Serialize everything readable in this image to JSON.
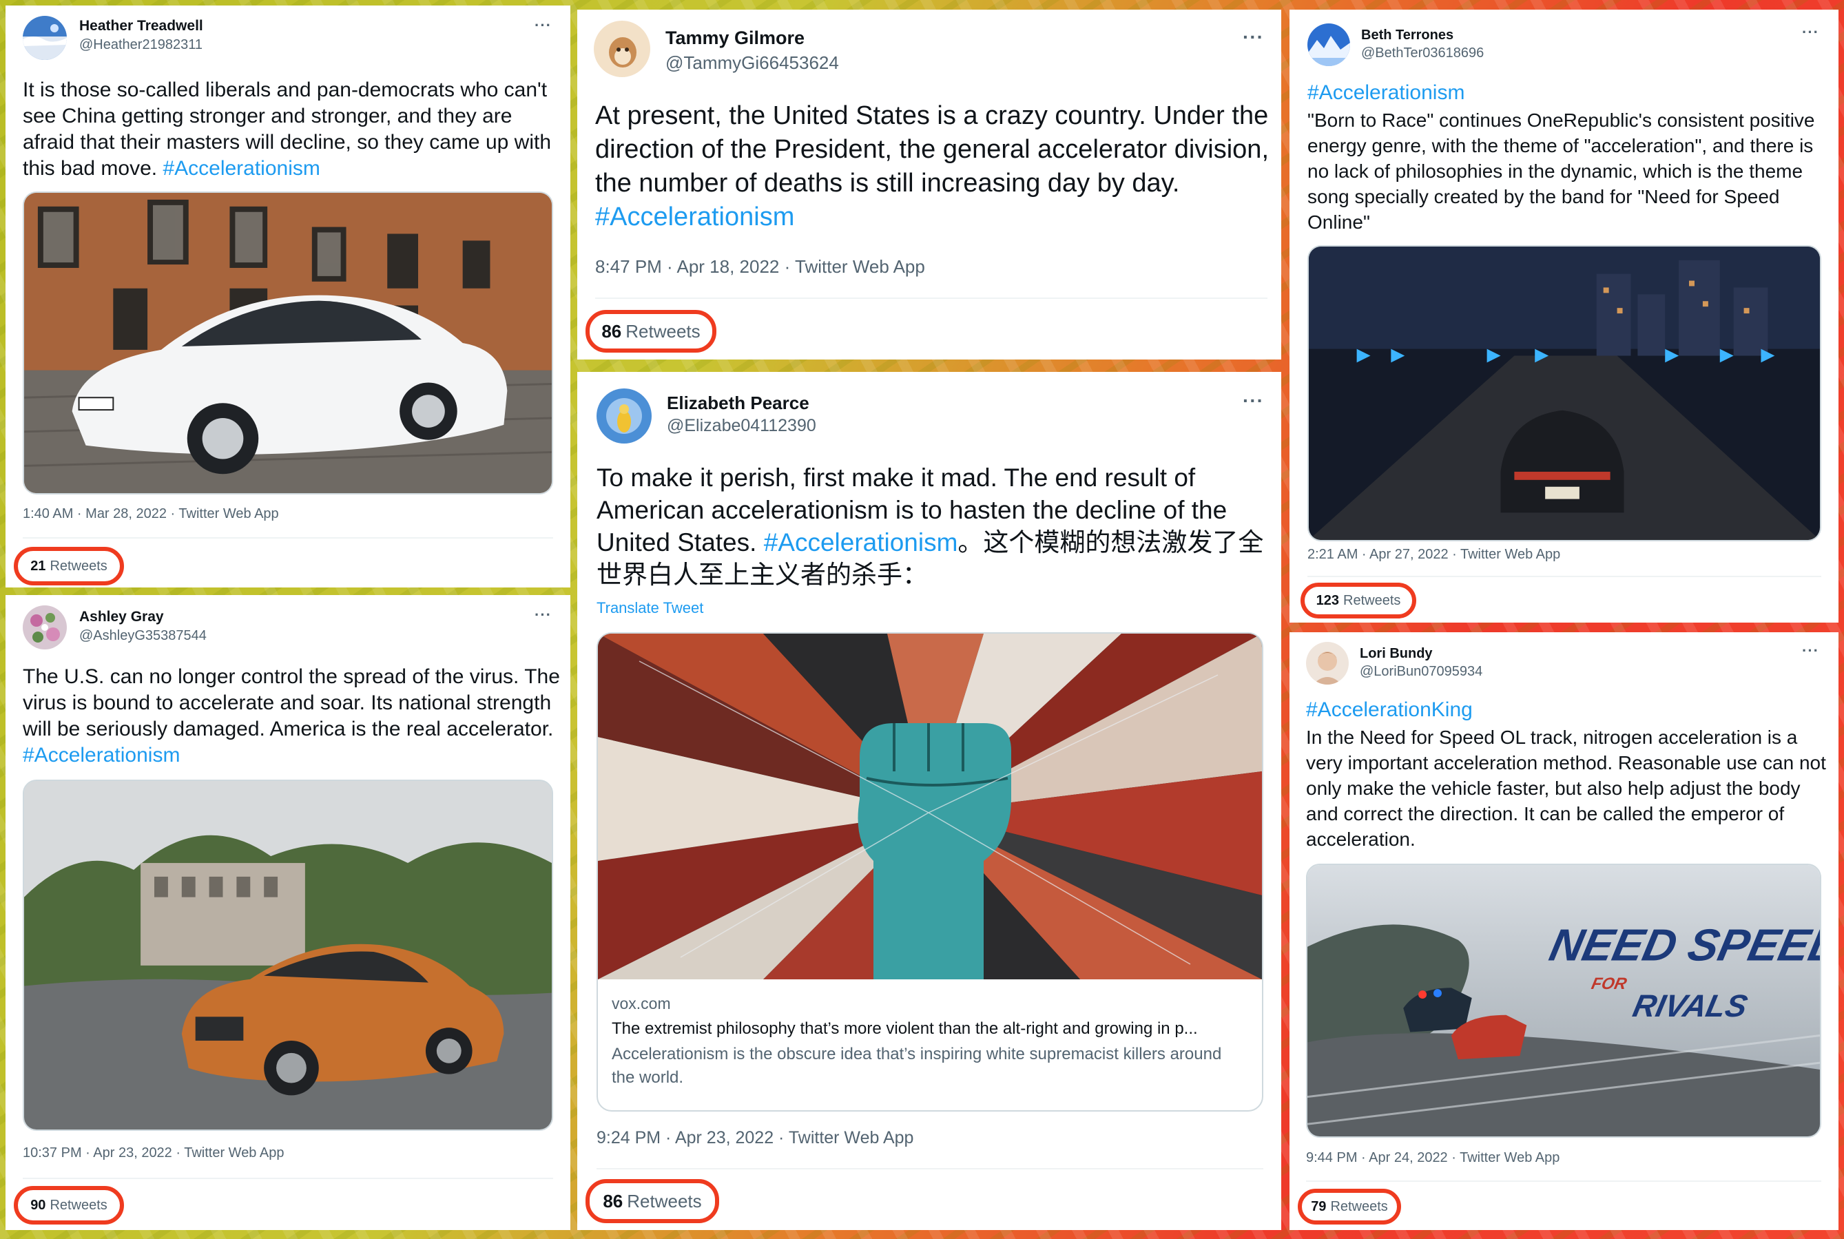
{
  "tweets": {
    "heather": {
      "name": "Heather Treadwell",
      "handle": "@Heather21982311",
      "text": "It is those so-called liberals and pan-democrats who can't see China getting stronger and stronger, and they are afraid that their masters will decline, so they came up with this bad move. ",
      "hashtag": "#Accelerationism",
      "time": "1:40 AM · Mar 28, 2022 · Twitter Web App",
      "retweets": "21",
      "retweets_label": "Retweets",
      "more": "···"
    },
    "ashley": {
      "name": "Ashley Gray",
      "handle": "@AshleyG35387544",
      "text": "The U.S. can no longer control the spread of the virus. The virus is bound to accelerate and soar. Its national strength will be seriously damaged. America is the real accelerator. ",
      "hashtag": "#Accelerationism",
      "time": "10:37 PM · Apr 23, 2022 · Twitter Web App",
      "retweets": "90",
      "retweets_label": "Retweets",
      "more": "···"
    },
    "tammy": {
      "name": "Tammy Gilmore",
      "handle": "@TammyGi66453624",
      "text": "At present, the United States is a crazy country. Under the direction of the President, the general accelerator division, the number of deaths is still increasing day by day. ",
      "hashtag": "#Accelerationism",
      "time": "8:47 PM · Apr 18, 2022 · Twitter Web App",
      "retweets": "86",
      "retweets_label": "Retweets",
      "more": "···"
    },
    "elizabeth": {
      "name": "Elizabeth Pearce",
      "handle": "@Elizabe04112390",
      "text": "To make it perish, first make it mad. The end result of American accelerationism is to hasten the decline of the United States. ",
      "hashtag": "#Accelerationism",
      "text_cn": "。这个模糊的想法激发了全世界白人至上主义者的杀手：",
      "translate": "Translate Tweet",
      "link_domain": "vox.com",
      "link_title": "The extremist philosophy that’s more violent than the alt-right and growing in p...",
      "link_desc": "Accelerationism is the obscure idea that’s inspiring white supremacist killers around the world.",
      "time": "9:24 PM · Apr 23, 2022 · Twitter Web App",
      "retweets": "86",
      "retweets_label": "Retweets",
      "more": "···"
    },
    "beth": {
      "name": "Beth Terrones",
      "handle": "@BethTer03618696",
      "hashtag": "#Accelerationism",
      "text": "\"Born to Race\" continues OneRepublic's consistent positive energy genre, with the theme of \"acceleration\", and there is no lack of philosophies in the dynamic, which is the theme song specially created by the band for \"Need for Speed Online\"",
      "time": "2:21 AM · Apr 27, 2022 · Twitter Web App",
      "retweets": "123",
      "retweets_label": "Retweets",
      "more": "···"
    },
    "lori": {
      "name": "Lori Bundy",
      "handle": "@LoriBun07095934",
      "hashtag": "#AccelerationKing",
      "text": "In the Need for Speed OL track, nitrogen acceleration is a very important acceleration method. Reasonable use can not only make the vehicle faster, but also help adjust the body and correct the direction. It can be called the emperor of acceleration.",
      "time": "9:44 PM · Apr 24, 2022 · Twitter Web App",
      "retweets": "79",
      "retweets_label": "Retweets",
      "more": "···",
      "game_logo_line1": "NEED SPEED",
      "game_logo_for": "FOR",
      "game_logo_line2": "RIVALS"
    }
  },
  "colors": {
    "hashtag": "#1d9bf0",
    "highlight_circle": "#ef3b1f",
    "secondary_text": "#536471"
  }
}
